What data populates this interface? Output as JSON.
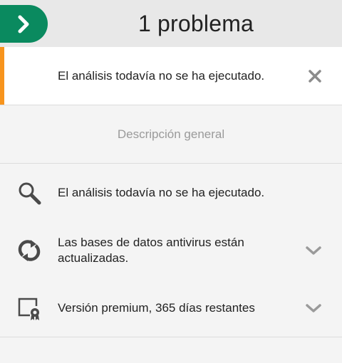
{
  "header": {
    "title": "1 problema",
    "back_icon": "chevron-right-icon",
    "accent_color": "#0a8a5f"
  },
  "alert": {
    "text": "El análisis todavía no se ha ejecutado.",
    "severity_color": "#f7941d",
    "dismiss_icon": "close-icon"
  },
  "overview": {
    "title": "Descripción general"
  },
  "status_items": [
    {
      "icon": "search-icon",
      "text": "El análisis todavía no se ha ejecutado.",
      "expandable": false
    },
    {
      "icon": "refresh-icon",
      "text": "Las bases de datos antivirus están actualizadas.",
      "expandable": true
    },
    {
      "icon": "certificate-icon",
      "text": "Versión premium, 365 días restantes",
      "expandable": true
    }
  ]
}
